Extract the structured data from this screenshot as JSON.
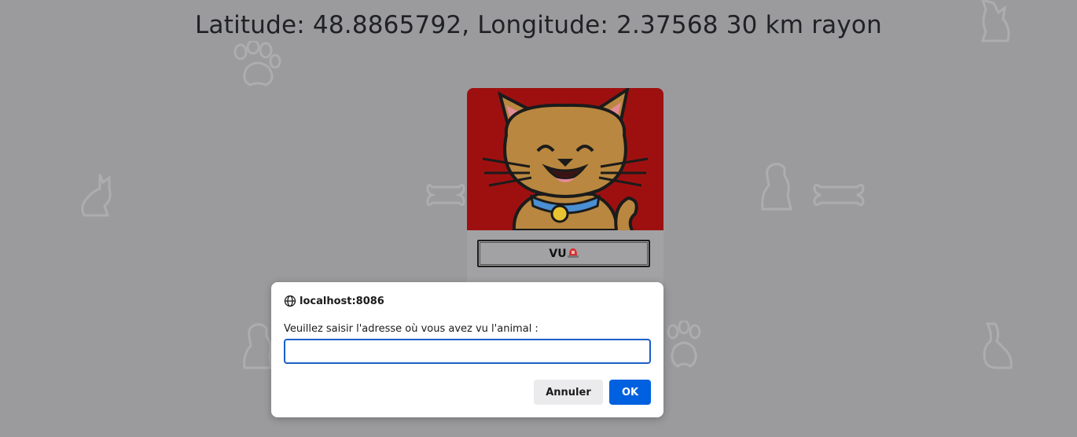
{
  "header": {
    "title": "Latitude: 48.8865792, Longitude: 2.37568 30 km rayon"
  },
  "card": {
    "button_label": "VU",
    "button_icon": "siren-icon"
  },
  "dialog": {
    "origin": "localhost:8086",
    "message": "Veuillez saisir l'adresse où vous avez vu l'animal :",
    "input_value": "",
    "cancel_label": "Annuler",
    "ok_label": "OK"
  },
  "colors": {
    "accent": "#0061e0",
    "card_image_bg": "#9e1010",
    "overlay_bg": "#9b9b9d"
  }
}
